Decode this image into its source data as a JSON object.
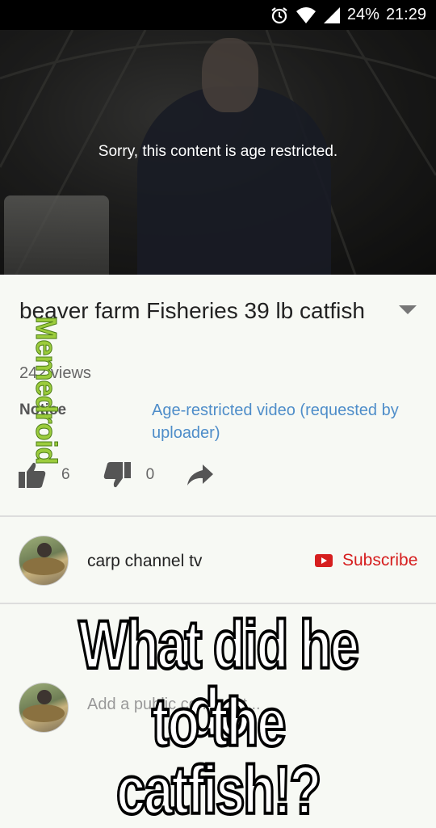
{
  "status_bar": {
    "battery": "24%",
    "time": "21:29"
  },
  "player": {
    "message": "Sorry, this content is age restricted."
  },
  "video": {
    "title": "beaver farm  Fisheries 39 lb catfish",
    "views": "242 views",
    "notice_label": "Notice",
    "notice_text": "Age-restricted video (requested by uploader)",
    "likes": "6",
    "dislikes": "0"
  },
  "channel": {
    "name": "carp channel tv",
    "subscribe_label": "Subscribe"
  },
  "comments": {
    "placeholder": "Add a public comment..."
  },
  "watermark": "Memedroid",
  "meme_caption": {
    "line1": "What did he do",
    "line2": "to the catfish!?"
  },
  "icons": [
    "alarm-icon",
    "wifi-icon",
    "signal-icon",
    "expand-icon",
    "thumbs-up-icon",
    "thumbs-down-icon",
    "share-icon",
    "youtube-icon"
  ]
}
